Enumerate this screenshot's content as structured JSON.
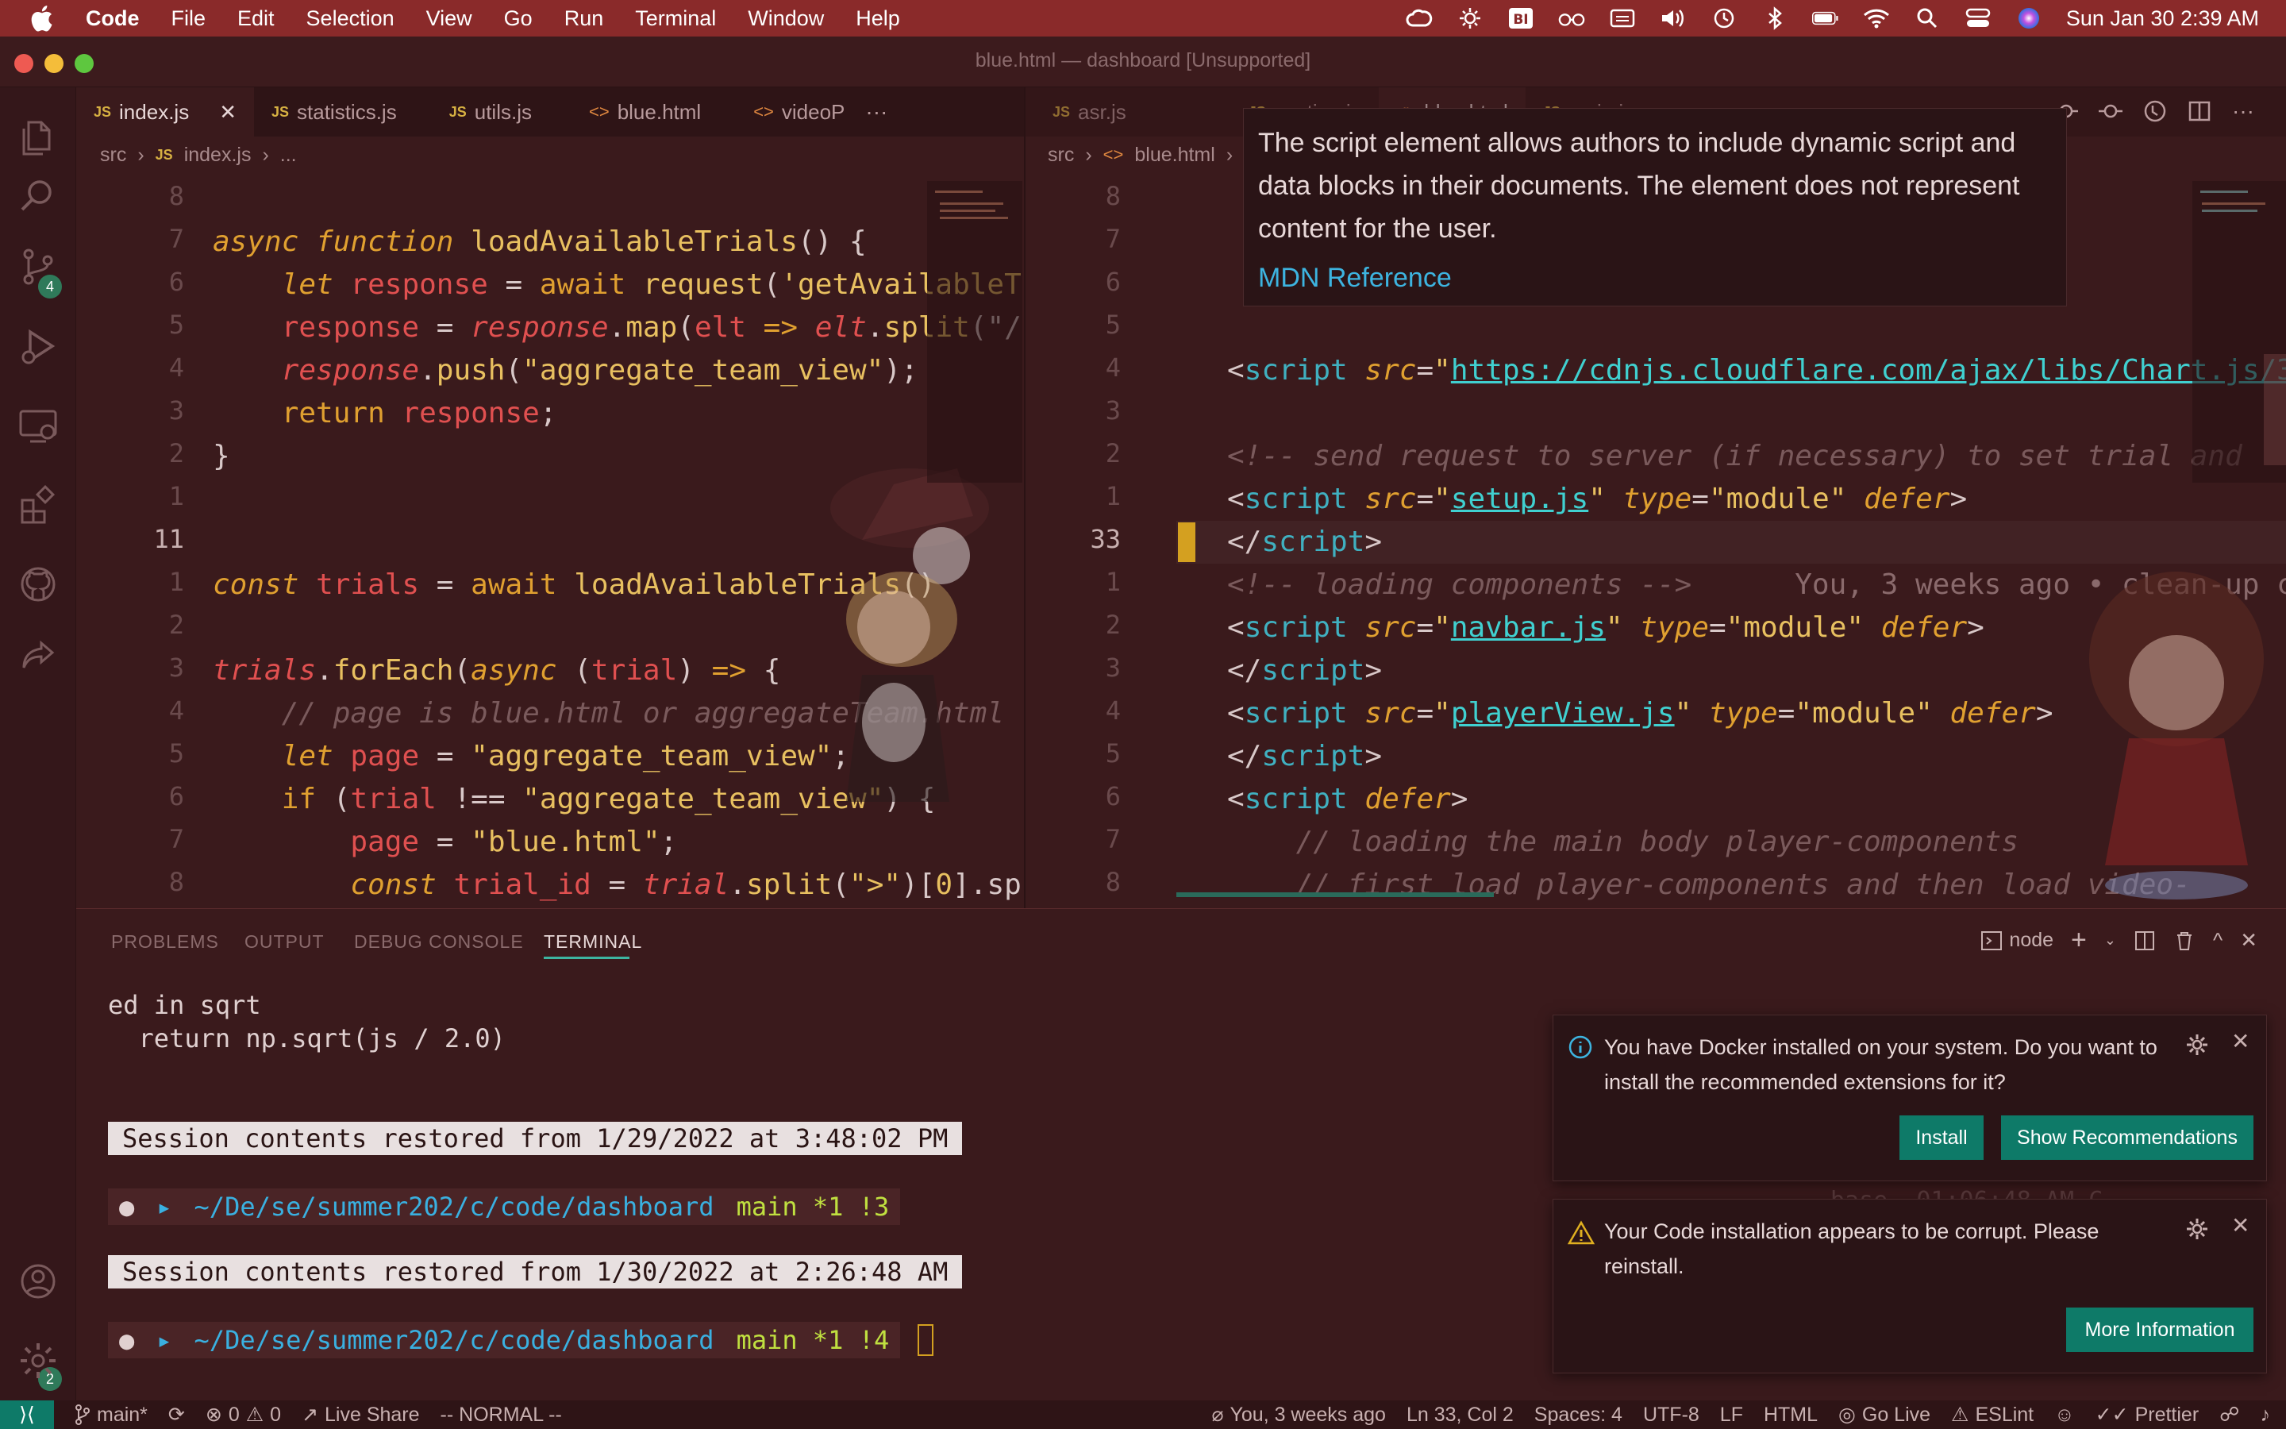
{
  "menubar": {
    "app": "Code",
    "items": [
      "File",
      "Edit",
      "Selection",
      "View",
      "Go",
      "Run",
      "Terminal",
      "Window",
      "Help"
    ],
    "clock": "Sun Jan 30  2:39 AM"
  },
  "window_title": "blue.html — dashboard [Unsupported]",
  "activity_badges": {
    "scm": "4",
    "accounts": "2"
  },
  "left_editor": {
    "tabs": [
      {
        "icon": "JS",
        "label": "index.js"
      },
      {
        "icon": "JS",
        "label": "statistics.js"
      },
      {
        "icon": "JS",
        "label": "utils.js"
      },
      {
        "icon": "<>",
        "label": "blue.html"
      },
      {
        "icon": "<>",
        "label": "videoP"
      }
    ],
    "more": "···",
    "breadcrumb": [
      "src",
      "index.js",
      "..."
    ],
    "line_numbers": [
      "8",
      "7",
      "6",
      "5",
      "4",
      "3",
      "2",
      "1",
      "11",
      "1",
      "2",
      "3",
      "4",
      "5",
      "6",
      "7",
      "8"
    ]
  },
  "right_editor": {
    "tabs": [
      {
        "icon": "JS",
        "label": "asr.js"
      },
      {
        "icon": "JS",
        "label": "ovation.js"
      },
      {
        "icon": "<>",
        "label": "blue.html"
      },
      {
        "icon": "JS",
        "label": "main.js"
      }
    ],
    "breadcrumb": [
      "src",
      "blue.html"
    ],
    "line_numbers": [
      "8",
      "7",
      "6",
      "5",
      "4",
      "3",
      "2",
      "1",
      "33",
      "1",
      "2",
      "3",
      "4",
      "5",
      "6",
      "7",
      "8"
    ],
    "blame": "You, 3 weeks ago • clean-up c"
  },
  "hover": {
    "text": "The script element allows authors to include dynamic script and data blocks in their documents. The element does not represent content for the user.",
    "link": "MDN Reference"
  },
  "panel": {
    "tabs": [
      "PROBLEMS",
      "OUTPUT",
      "DEBUG CONSOLE",
      "TERMINAL"
    ],
    "active_tab": "TERMINAL",
    "terminal_name": "node",
    "lines": [
      "ed in sqrt",
      "  return np.sqrt(js / 2.0)"
    ],
    "session1": "Session contents restored from 1/29/2022 at 3:48:02 PM",
    "session2": "Session contents restored from 1/30/2022 at 2:26:48 AM",
    "path": "~/De/se/summer202/c/code/dashboard",
    "git1": "main *1 !3",
    "git2": "main *1 !4",
    "right_prompt": "base  01:06:48 AM C"
  },
  "notifications": [
    {
      "type": "info",
      "text": "You have Docker installed on your system. Do you want to install the recommended extensions for it?",
      "buttons": [
        "Install",
        "Show Recommendations"
      ]
    },
    {
      "type": "warning",
      "text": "Your Code installation appears to be corrupt. Please reinstall.",
      "buttons": [
        "More Information"
      ]
    }
  ],
  "status": {
    "branch": "main*",
    "errors": "0",
    "warnings": "0",
    "live_share": "Live Share",
    "mode": "-- NORMAL --",
    "blame": "You, 3 weeks ago",
    "position": "Ln 33, Col 2",
    "spaces": "Spaces: 4",
    "encoding": "UTF-8",
    "eol": "LF",
    "language": "HTML",
    "go_live": "Go Live",
    "eslint": "ESLint",
    "prettier": "Prettier"
  },
  "colors": {
    "accent": "#0e7a68",
    "menubar": "#8a2a2a",
    "background": "#3a1a1c"
  }
}
